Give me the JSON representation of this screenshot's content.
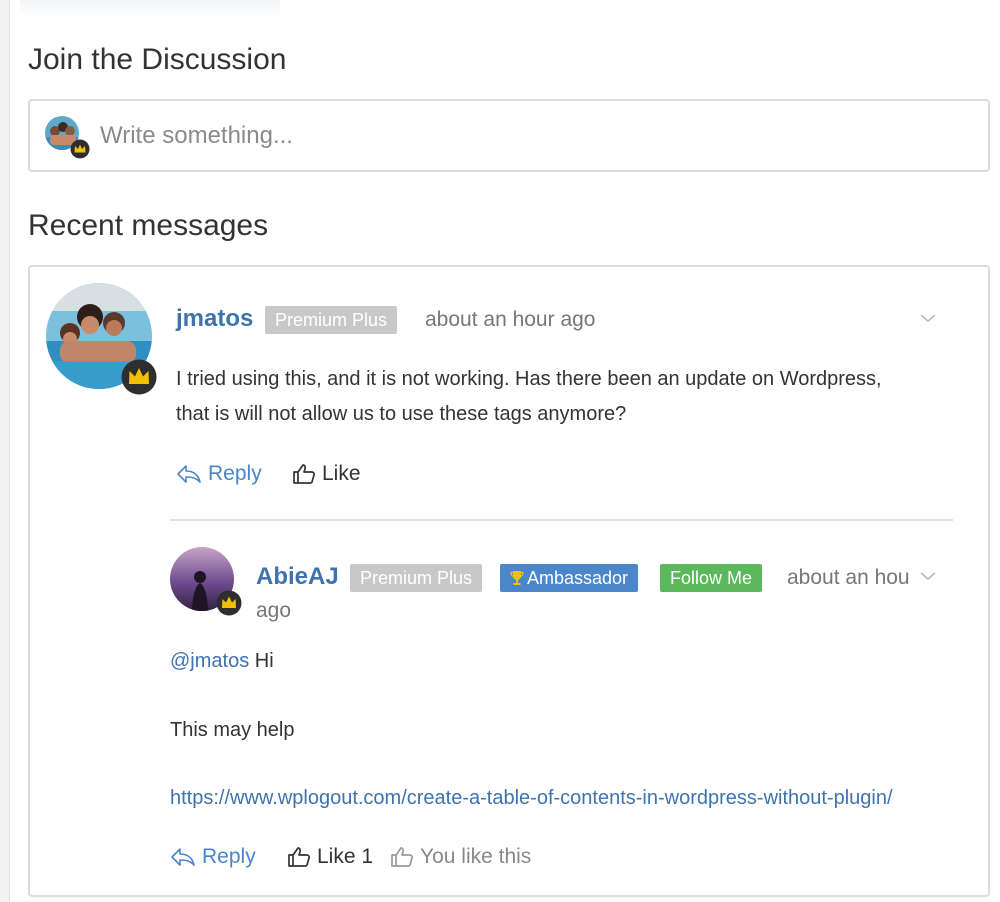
{
  "join": {
    "title": "Join the Discussion",
    "placeholder": "Write something..."
  },
  "recent": {
    "title": "Recent messages"
  },
  "messages": [
    {
      "author": "jmatos",
      "badges": [
        "Premium Plus"
      ],
      "time": "about an hour ago",
      "text_lines": [
        "I tried using this, and it is not working. Has there been an update on Wordpress,",
        "that is will not allow us to use these tags anymore?"
      ],
      "actions": {
        "reply": "Reply",
        "like": "Like"
      },
      "replies": [
        {
          "author": "AbieAJ",
          "badges": [
            "Premium Plus",
            "Ambassador",
            "Follow Me"
          ],
          "time_line1": "about an hou",
          "time_line2": "ago",
          "mention": "@jmatos",
          "greeting": "Hi",
          "body": "This may help",
          "link": "https://www.wplogout.com/create-a-table-of-contents-in-wordpress-without-plugin/",
          "actions": {
            "reply": "Reply",
            "like": "Like 1",
            "liked_note": "You like this"
          }
        }
      ]
    }
  ],
  "colors": {
    "link": "#3f73b0",
    "premium_badge": "#c8c8c8",
    "ambassador_badge": "#4a86c8",
    "follow_badge": "#5cb85c"
  },
  "icons": [
    "crown-icon",
    "trophy-icon",
    "reply-icon",
    "thumbs-up-icon",
    "chevron-down-icon"
  ]
}
